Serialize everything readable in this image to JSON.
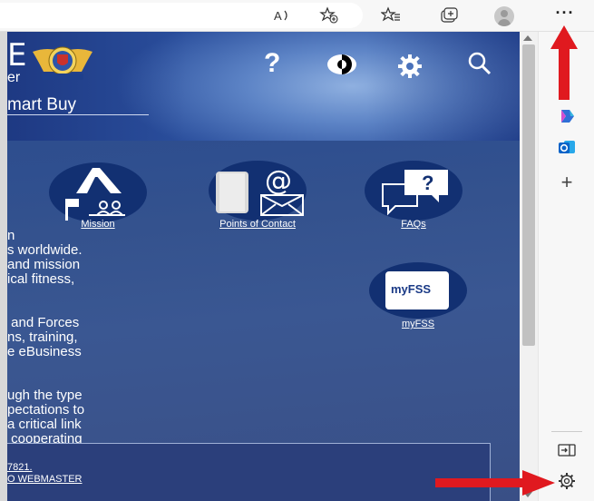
{
  "toolbar": {
    "icons": [
      "read-aloud-icon",
      "add-favorite-icon",
      "favorites-icon",
      "collections-icon",
      "profile-avatar",
      "more-icon"
    ],
    "more_label": "···"
  },
  "header": {
    "brand_letter": "E",
    "brand_sub": "er",
    "subtitle": "mart Buy"
  },
  "tiles": [
    {
      "label": "Mission",
      "icon": "mission-icon"
    },
    {
      "label": "Points of Contact",
      "icon": "contact-icon"
    },
    {
      "label": "FAQs",
      "icon": "faq-icon"
    },
    {
      "label": "myFSS",
      "icon": "myfss-icon",
      "badge": "myFSS"
    }
  ],
  "body_text": "n\ns worldwide.\nand mission\nical fitness,\n\n\n and Forces\nns, training,\ne eBusiness\n\n\nugh the type\npectations to\na critical link\n cooperating",
  "footer": {
    "line1": "7821.",
    "line2": "O WEBMASTER"
  },
  "sidebar": {
    "items": [
      "copilot-icon",
      "outlook-icon",
      "add-icon",
      "hide-sidebar-icon",
      "settings-icon"
    ],
    "add_label": "+"
  },
  "annotations": {
    "color": "#e0191f"
  }
}
